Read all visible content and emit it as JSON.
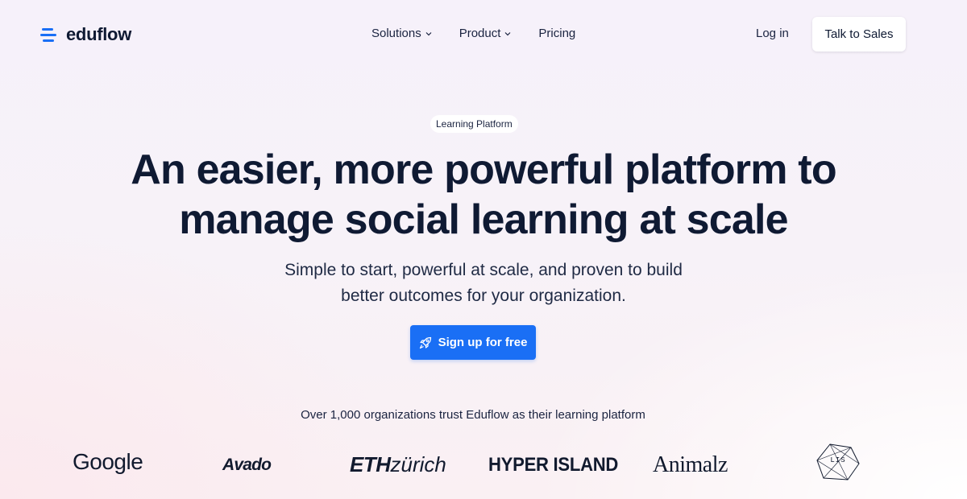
{
  "header": {
    "logo_text": "eduflow",
    "nav": [
      {
        "label": "Solutions",
        "has_dropdown": true
      },
      {
        "label": "Product",
        "has_dropdown": true
      },
      {
        "label": "Pricing",
        "has_dropdown": false
      }
    ],
    "login_label": "Log in",
    "sales_label": "Talk to Sales"
  },
  "hero": {
    "badge": "Learning Platform",
    "headline": [
      "An easier, more powerful platform to",
      "manage social learning at scale"
    ],
    "subtext": [
      "Simple to start, powerful at scale, and proven to build",
      "better outcomes for your organization."
    ],
    "cta_label": "Sign up for free",
    "trust_text": "Over 1,000 organizations trust Eduflow as their learning platform"
  },
  "logos": {
    "google": "Google",
    "avado": "Avado",
    "eth_bold": "ETH",
    "eth_rest": "zürich",
    "hyper": "HYPER ISLAND",
    "animalz": "Animalz",
    "lis": "LIS"
  },
  "colors": {
    "accent": "#1a6ff5",
    "text_dark": "#0f1a33"
  }
}
